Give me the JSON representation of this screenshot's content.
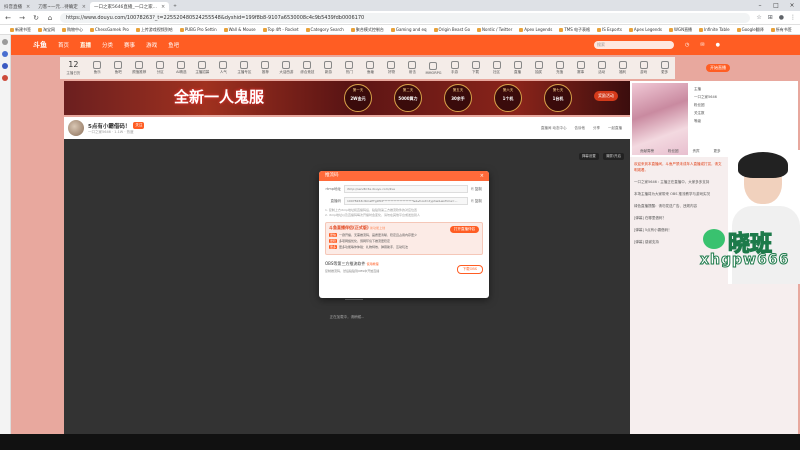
{
  "browser": {
    "tabs": [
      {
        "label": "抖音直播",
        "active": false
      },
      {
        "label": "刀客~一元...待确定",
        "active": false
      },
      {
        "label": "一口之家5646直播_一口之家...",
        "active": true
      }
    ],
    "new_tab": "+",
    "url": "https://www.douyu.com/10078263?_t=225520480524255548&dyshid=199f8b8-9107a6530008c4c9b5439fdb0006170",
    "bookmarks": [
      "新建书签",
      "淘宝网",
      "购物中心",
      "ChessGamek Pro",
      "上传游戏视频到哈",
      "PUBG Pro Settin",
      "Wall & Mouse",
      "Top 4ft - Rocket",
      "Category Search",
      "聚合模式控制台",
      "Gaming and eq",
      "Origin Beast Go",
      "Nordic / Twitter",
      "Apex Legends",
      "TMS 电子表格",
      "IS Esports",
      "Apex Legends",
      "WGN直播",
      "Infinite Table",
      "Google翻译",
      "所有书签"
    ]
  },
  "site": {
    "logo": "斗鱼",
    "nav": [
      "首页",
      "直播",
      "分类",
      "赛事",
      "游戏",
      "鱼吧"
    ],
    "active_nav": "直播",
    "search_placeholder": "搜索",
    "day_number": "12",
    "day_label": "主播日历",
    "categories": [
      "鱼乐",
      "鱼吧",
      "颜值推荐",
      "分区",
      "AI精选",
      "主播招募",
      "人气",
      "主播专区",
      "推荐",
      "大话西游",
      "综合竞技",
      "新游",
      "热门",
      "鱼塘",
      "好物",
      "射击",
      "MMORPG",
      "手游",
      "下载",
      "社区",
      "直播",
      "抽奖",
      "充值",
      "赛事",
      "活动",
      "福利",
      "游戏",
      "更多"
    ],
    "nav_upload": "开始直播"
  },
  "banner": {
    "title": "全新一人鬼服",
    "days": [
      {
        "label": "第一天",
        "value": "2W金元"
      },
      {
        "label": "第二天",
        "value": "5000算力"
      },
      {
        "label": "第五天",
        "value": "30余手"
      },
      {
        "label": "第六天",
        "value": "1个机"
      },
      {
        "label": "第七天",
        "value": "1台机"
      }
    ],
    "right_tag": "奖励活动"
  },
  "streamer": {
    "title": "5点有小霸借码！",
    "badge": "关注",
    "meta": "一口之家5646  ·  1.1W  ·  热度",
    "right_items": [
      "直播间\n动态中心",
      "告诉他",
      "分享",
      "一起直播"
    ]
  },
  "player": {
    "buttons": [
      "弹幕设置",
      "清屏/开启"
    ],
    "status": "正在加载中，请稍候..."
  },
  "modal": {
    "title": "推流码",
    "rtmp_label": "rtmp地址",
    "rtmp_value": "rtmp://sendtc3a.douyu.com/live",
    "code_label": "直播码",
    "code_value": "10078263rdbCaPTg9fCt********************&&vhost=dyphw&wsTime=...",
    "copy_label": "复制",
    "notes": [
      "1. 复制上方rtmp地址和直播码后，粘贴到第三方推流软件的对应位置",
      "2. rtmp地址以及直播码每次开播时会变化，请勿在其他平台或发给别人"
    ],
    "promo": {
      "title": "斗鱼直播伴侣(正式版)",
      "tag": "新功能上线",
      "button": "打开直播伴侣",
      "lines": [
        {
          "tag": "更快",
          "text": "一键开播，无需推流码，画质更清晰、稳定且占用内存更少"
        },
        {
          "tag": "更稳",
          "text": "多项网络优化，弱网环境下推流更稳定"
        },
        {
          "tag": "更多",
          "text": "更多功能等你体验：礼物特效、弹幕助手、互动玩法"
        }
      ]
    },
    "obs": {
      "title": "OBS等第三方推流软件",
      "tag": "使用教程",
      "desc": "复制推流码，然后粘贴到OBS中开始直播",
      "button": "下载OBS"
    }
  },
  "right_panel": {
    "tabs": [
      "贡献周榜",
      "粉丝团",
      "贵宾",
      "更多"
    ],
    "side_items": [
      "主播",
      "一口之家5646",
      "粉丝团",
      "关注数",
      "等级"
    ],
    "chat": [
      "欢迎来到本直播间，斗鱼严禁未成年人直播或打赏，请文明观看。",
      "一口之家5646 : 主播正在直播中，大家多多支持",
      "本场主播将为大家带来 OBS 推流教学与游戏实况",
      "绿色直播提醒：请勿发送广告、违规内容",
      "[弹幕] 在哪里借码？",
      "[弹幕] 5点有小霸借码！",
      "[弹幕] 感谢支持"
    ]
  },
  "webcam": {
    "watermark_line1": "晓班",
    "watermark_line2": "xhgpw666"
  },
  "colors": {
    "brand": "#ff5d23",
    "page_bg": "#e8a89e",
    "dark": "#333333"
  }
}
